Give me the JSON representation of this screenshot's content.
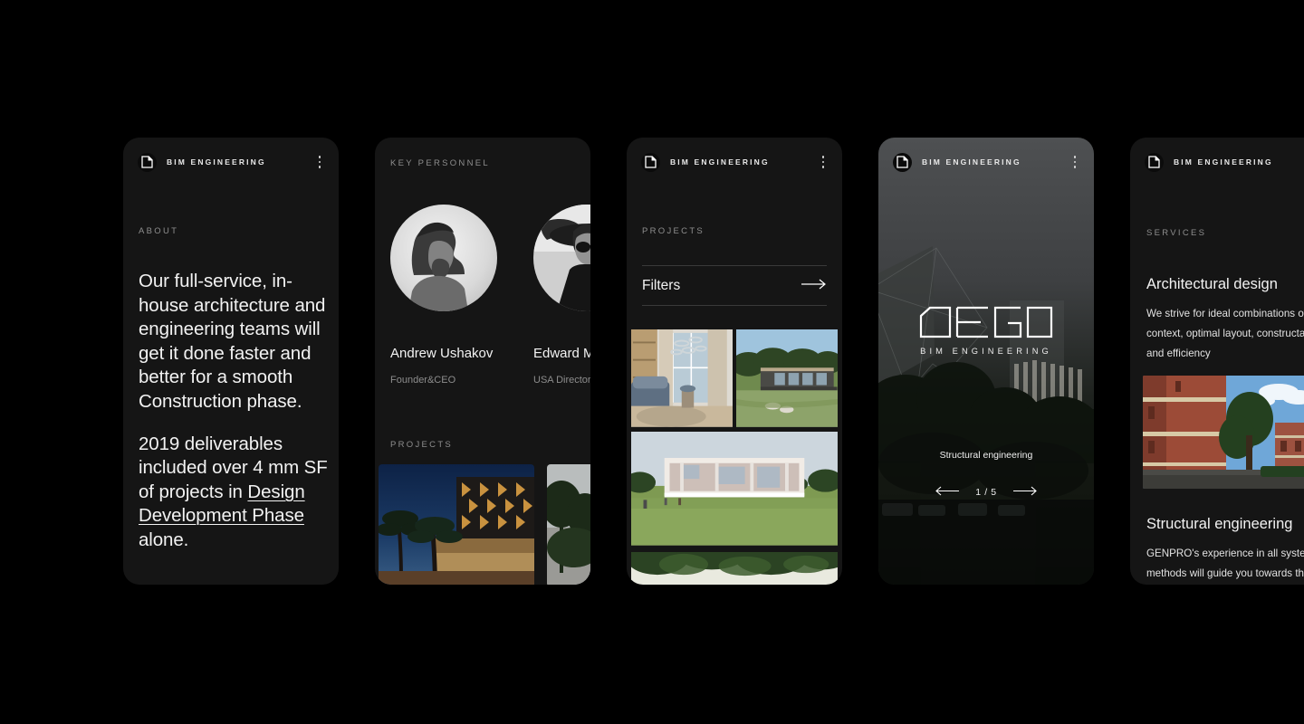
{
  "brand": {
    "name": "BIM ENGINEERING",
    "logo_icon": "document-corner-icon",
    "menu_icon": "kebab-menu-icon"
  },
  "cards": [
    {
      "id": "about-card",
      "section_label": "ABOUT",
      "paragraph_1": "Our full-service, in-house architecture and engineering teams will get it done faster and better for a smooth Construction phase.",
      "paragraph_2_pre": "2019 deliverables included over 4 mm SF of projects in ",
      "paragraph_2_link": "Design Development Phase",
      "paragraph_2_post": " alone."
    },
    {
      "id": "personnel-card",
      "section_label": "KEY PERSONNEL",
      "projects_label": "PROJECTS",
      "people": [
        {
          "name": "Andrew Ushakov",
          "role": "Founder&CEO",
          "avatar": "portrait-man-beard-cap"
        },
        {
          "name": "Edward M",
          "role": "USA Director",
          "avatar": "portrait-man-hat-sunglasses"
        }
      ]
    },
    {
      "id": "projects-card",
      "section_label": "PROJECTS",
      "filters_label": "Filters",
      "filters_arrow_icon": "arrow-right-icon",
      "thumbnails": [
        "interior-bedroom-render",
        "modern-house-lawn-render",
        "long-white-pavilion-render",
        "trees-foliage-render"
      ]
    },
    {
      "id": "hero-card",
      "logo_word": "DEGO",
      "logo_sub": "BIM ENGINEERING",
      "caption": "Structural engineering",
      "slide_counter": "1 / 5",
      "prev_icon": "arrow-left-icon",
      "next_icon": "arrow-right-icon"
    },
    {
      "id": "services-card",
      "section_label": "SERVICES",
      "services": [
        {
          "title": "Architectural design",
          "body": "We strive for ideal combinations of design\ncontext, optimal layout, constructability\nand efficiency",
          "image": "red-brick-courtyard-render"
        },
        {
          "title": "Structural engineering",
          "body": "GENPRO's experience in all systems &\nmethods will guide you towards the"
        }
      ]
    }
  ],
  "colors": {
    "page_background": "#000000",
    "card_background": "#151515",
    "text_primary": "#f2f2f2",
    "text_muted": "#8e8e8e",
    "divider": "#3a3a3a"
  }
}
